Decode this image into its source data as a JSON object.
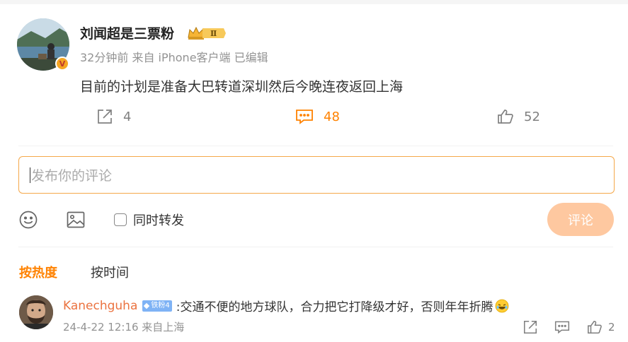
{
  "post": {
    "username": "刘闻超是三票粉",
    "level_badge": "Ⅱ",
    "verified_badge": "V",
    "meta": "32分钟前 来自 iPhone客户端 已编辑",
    "content": "目前的计划是准备大巴转道深圳然后今晚连夜返回上海",
    "actions": {
      "share_count": "4",
      "comment_count": "48",
      "like_count": "52"
    }
  },
  "compose": {
    "placeholder": "发布你的评论",
    "repost_label": "同时转发",
    "submit_label": "评论"
  },
  "tabs": {
    "hot": "按热度",
    "time": "按时间"
  },
  "comments": [
    {
      "author": "Kanechguha",
      "fan_badge": "铁粉4",
      "text": ":交通不便的地方球队，合力把它打降级才好，否则年年折腾",
      "meta": "24-4-22 12:16 来自上海",
      "like_count": "2"
    }
  ],
  "colors": {
    "accent": "#ff8200",
    "username_link": "#eb7340",
    "submit_disabled": "#fec8a0",
    "input_border": "#f5a84a"
  },
  "icons": {
    "share": "share-icon",
    "comment": "comment-icon",
    "like": "thumbs-up-icon",
    "emoji": "emoji-icon",
    "image": "image-icon"
  }
}
